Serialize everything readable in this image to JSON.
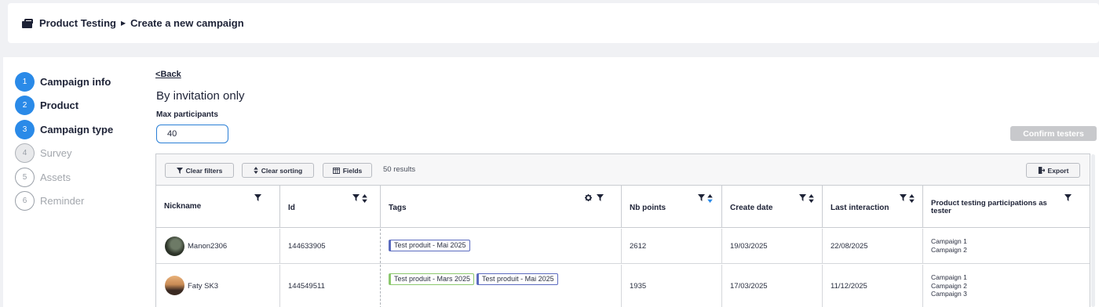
{
  "breadcrumb": {
    "root": "Product Testing",
    "current": "Create a new campaign"
  },
  "steps": [
    {
      "num": "1",
      "label": "Campaign info",
      "state": "active"
    },
    {
      "num": "2",
      "label": "Product",
      "state": "active"
    },
    {
      "num": "3",
      "label": "Campaign type",
      "state": "active"
    },
    {
      "num": "4",
      "label": "Survey",
      "state": "inactive"
    },
    {
      "num": "5",
      "label": "Assets",
      "state": "inactive"
    },
    {
      "num": "6",
      "label": "Reminder",
      "state": "inactive"
    }
  ],
  "back_label": "Back",
  "page_title": "By invitation only",
  "max_participants": {
    "label": "Max participants",
    "value": "40"
  },
  "confirm_label": "Confirm testers",
  "toolbar": {
    "clear_filters": "Clear filters",
    "clear_sorting": "Clear sorting",
    "fields": "Fields",
    "results": "50 results",
    "export": "Export"
  },
  "columns": {
    "nickname": "Nickname",
    "id": "Id",
    "tags": "Tags",
    "nb_points": "Nb points",
    "create_date": "Create date",
    "last_interaction": "Last interaction",
    "participations": "Product testing participations as tester"
  },
  "rows": [
    {
      "nickname": "Manon2306",
      "id": "144633905",
      "tags": [
        "Test produit - Mai 2025"
      ],
      "nb_points": "2612",
      "create_date": "19/03/2025",
      "last_interaction": "22/08/2025",
      "participations": [
        "Campaign 1",
        "Campaign 2"
      ]
    },
    {
      "nickname": "Faty SK3",
      "id": "144549511",
      "tags": [
        "Test produit - Mars 2025",
        "Test produit - Mai 2025"
      ],
      "nb_points": "1935",
      "create_date": "17/03/2025",
      "last_interaction": "11/12/2025",
      "participations": [
        "Campaign 1",
        "Campaign 2",
        "Campaign 3"
      ]
    }
  ],
  "colors": {
    "accent": "#2a8ae8",
    "tag_blue": "#5b6bbf",
    "tag_green": "#8cc86e",
    "disabled": "#c8c9cc"
  }
}
